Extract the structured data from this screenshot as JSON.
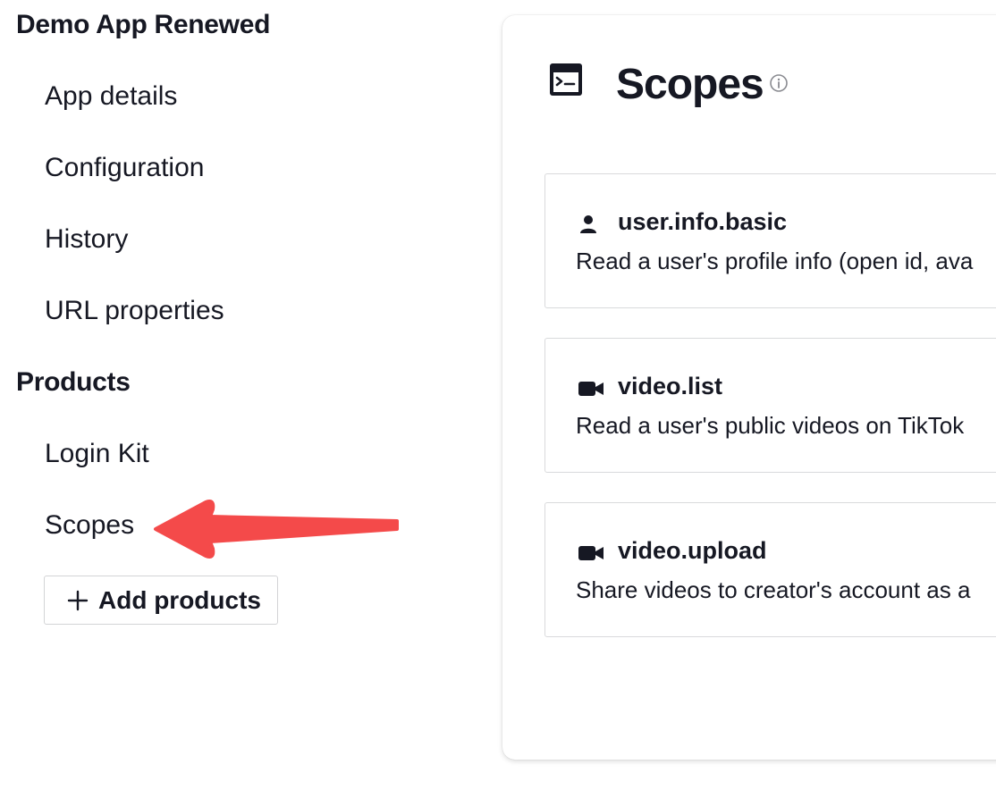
{
  "sidebar": {
    "app_title": "Demo App Renewed",
    "app_items": [
      {
        "label": "App details"
      },
      {
        "label": "Configuration"
      },
      {
        "label": "History"
      },
      {
        "label": "URL properties"
      }
    ],
    "products_title": "Products",
    "product_items": [
      {
        "label": "Login Kit"
      },
      {
        "label": "Scopes"
      }
    ],
    "add_products_label": "Add products",
    "add_products_icon": "plus-icon"
  },
  "annotation": {
    "arrow_color": "#f44a4a",
    "points_to": "Scopes"
  },
  "main": {
    "title": "Scopes",
    "title_icon": "terminal-window-icon",
    "info_icon": "info-icon",
    "scopes": [
      {
        "name": "user.info.basic",
        "icon": "user-icon",
        "description": "Read a user's profile info (open id, ava"
      },
      {
        "name": "video.list",
        "icon": "video-camera-icon",
        "description": "Read a user's public videos on TikTok"
      },
      {
        "name": "video.upload",
        "icon": "video-camera-icon",
        "description": "Share videos to creator's account as a"
      }
    ]
  },
  "colors": {
    "text": "#161823",
    "border": "#d9dadc",
    "accent_arrow": "#f44a4a"
  }
}
